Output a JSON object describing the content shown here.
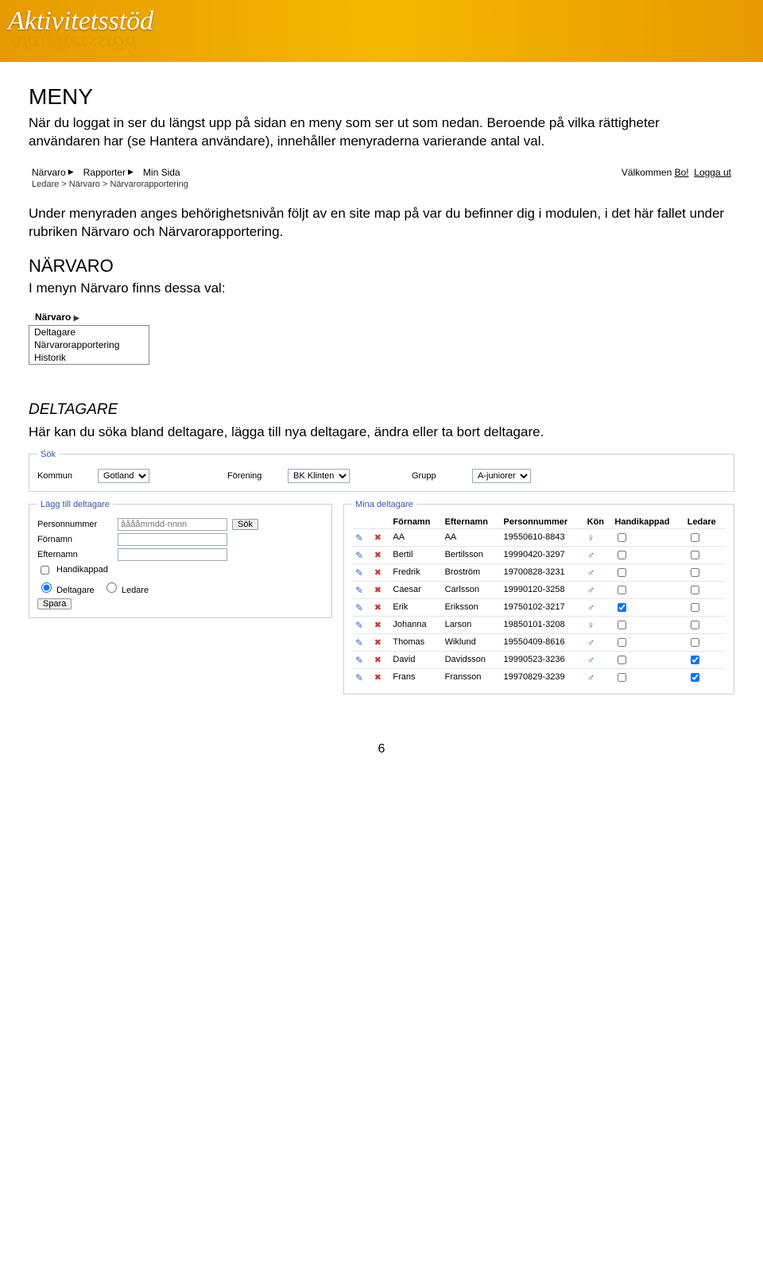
{
  "banner": {
    "title": "Aktivitetsstöd"
  },
  "section_meny": {
    "heading": "MENY",
    "p1": "När du loggat in ser du längst upp på sidan en meny som ser ut som nedan. Beroende på vilka rättigheter användaren har (se Hantera användare), innehåller menyraderna varierande antal val.",
    "p2": "Under menyraden anges behörighetsnivån följt av en site map på var du befinner dig i modulen, i det här fallet under rubriken Närvaro och Närvarorapportering."
  },
  "menubar": {
    "items": [
      "Närvaro",
      "Rapporter",
      "Min Sida"
    ],
    "welcome_prefix": "Välkommen ",
    "welcome_user": "Bo!",
    "logout": "Logga ut"
  },
  "breadcrumb": "Ledare > Närvaro > Närvarorapportering",
  "section_narvaro": {
    "heading": "NÄRVARO",
    "p": "I menyn Närvaro finns dessa val:"
  },
  "dropdown": {
    "head": "Närvaro",
    "items": [
      "Deltagare",
      "Närvarorapportering",
      "Historik"
    ]
  },
  "section_deltagare": {
    "heading": "DELTAGARE",
    "p": "Här kan du söka bland deltagare, lägga till nya deltagare, ändra eller ta bort deltagare."
  },
  "sok": {
    "legend": "Sök",
    "kommun_label": "Kommun",
    "kommun_value": "Gotland",
    "forening_label": "Förening",
    "forening_value": "BK Klinten",
    "grupp_label": "Grupp",
    "grupp_value": "A-juniorer"
  },
  "legg": {
    "legend": "Lägg till deltagare",
    "personnummer_label": "Personnummer",
    "personnummer_placeholder": "ååååmmdd-nnnn",
    "sok_btn": "Sök",
    "fornamn_label": "Förnamn",
    "efternamn_label": "Efternamn",
    "handikappad": "Handikappad",
    "deltagare": "Deltagare",
    "ledare": "Ledare",
    "spara": "Spara"
  },
  "mina": {
    "legend": "Mina deltagare",
    "headers": [
      "Förnamn",
      "Efternamn",
      "Personnummer",
      "Kön",
      "Handikappad",
      "Ledare"
    ],
    "rows": [
      {
        "f": "AA",
        "e": "AA",
        "p": "19550610-8843",
        "g": "f",
        "h": false,
        "l": false
      },
      {
        "f": "Bertil",
        "e": "Bertilsson",
        "p": "19990420-3297",
        "g": "m",
        "h": false,
        "l": false
      },
      {
        "f": "Fredrik",
        "e": "Broström",
        "p": "19700828-3231",
        "g": "m",
        "h": false,
        "l": false
      },
      {
        "f": "Caesar",
        "e": "Carlsson",
        "p": "19990120-3258",
        "g": "m",
        "h": false,
        "l": false
      },
      {
        "f": "Erik",
        "e": "Eriksson",
        "p": "19750102-3217",
        "g": "m",
        "h": true,
        "l": false
      },
      {
        "f": "Johanna",
        "e": "Larson",
        "p": "19850101-3208",
        "g": "f",
        "h": false,
        "l": false
      },
      {
        "f": "Thomas",
        "e": "Wiklund",
        "p": "19550409-8616",
        "g": "m",
        "h": false,
        "l": false
      },
      {
        "f": "David",
        "e": "Davidsson",
        "p": "19990523-3236",
        "g": "m",
        "h": false,
        "l": true
      },
      {
        "f": "Frans",
        "e": "Fransson",
        "p": "19970829-3239",
        "g": "m",
        "h": false,
        "l": true
      }
    ]
  },
  "page_number": "6"
}
